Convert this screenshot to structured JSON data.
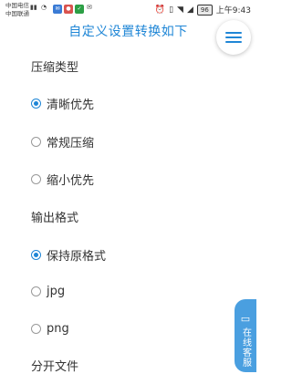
{
  "status_bar": {
    "carrier1": "中国电信",
    "carrier2": "中国联通",
    "battery": "96",
    "time": "上午9:43"
  },
  "header": {
    "title": "自定义设置转换如下"
  },
  "sections": {
    "compress_title": "压缩类型",
    "compress_options": [
      "清晰优先",
      "常规压缩",
      "缩小优先"
    ],
    "output_title": "输出格式",
    "output_options": [
      "保持原格式",
      "jpg",
      "png"
    ],
    "more_title": "分开文件"
  },
  "service": {
    "label": "在线客服"
  }
}
